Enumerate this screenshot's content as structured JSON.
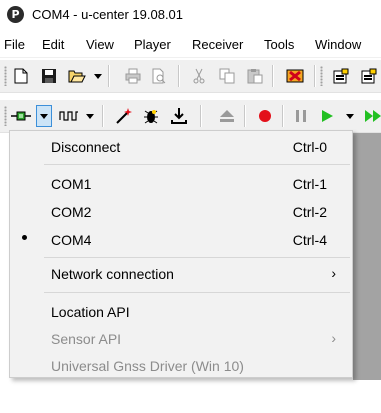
{
  "window": {
    "title": "COM4 - u-center 19.08.01",
    "logo_letter": "P"
  },
  "menubar": {
    "items": [
      "File",
      "Edit",
      "View",
      "Player",
      "Receiver",
      "Tools",
      "Window"
    ]
  },
  "toolbar1": {
    "icons": [
      "new-file-icon",
      "save-icon",
      "open-folder-icon",
      "print-icon",
      "print-preview-icon",
      "cut-icon",
      "copy-icon",
      "paste-icon",
      "delete-icon",
      "docking-window-icon",
      "docking-window-2-icon"
    ]
  },
  "toolbar2": {
    "icons": [
      "connection-icon",
      "baudrate-icon",
      "autobauding-icon",
      "debug-icon",
      "logfile-icon",
      "eject-icon",
      "record-icon",
      "pause-icon",
      "play-icon",
      "fast-forward-icon"
    ]
  },
  "colors": {
    "record": "#e3101a",
    "play": "#22c022",
    "highlight": "#cce4f7",
    "highlight_border": "#3c8fd9"
  },
  "menu": {
    "items": [
      {
        "label": "Disconnect",
        "shortcut": "Ctrl-0",
        "checked": false,
        "disabled": false
      },
      {
        "label": "COM1",
        "shortcut": "Ctrl-1",
        "checked": false,
        "disabled": false
      },
      {
        "label": "COM2",
        "shortcut": "Ctrl-2",
        "checked": false,
        "disabled": false
      },
      {
        "label": "COM4",
        "shortcut": "Ctrl-4",
        "checked": true,
        "disabled": false
      },
      {
        "label": "Network connection",
        "submenu": "›",
        "disabled": false
      },
      {
        "label": "Location API",
        "disabled": false
      },
      {
        "label": "Sensor API",
        "submenu": "›",
        "disabled": true
      },
      {
        "label": "Universal Gnss Driver (Win 10)",
        "disabled": true
      }
    ]
  }
}
